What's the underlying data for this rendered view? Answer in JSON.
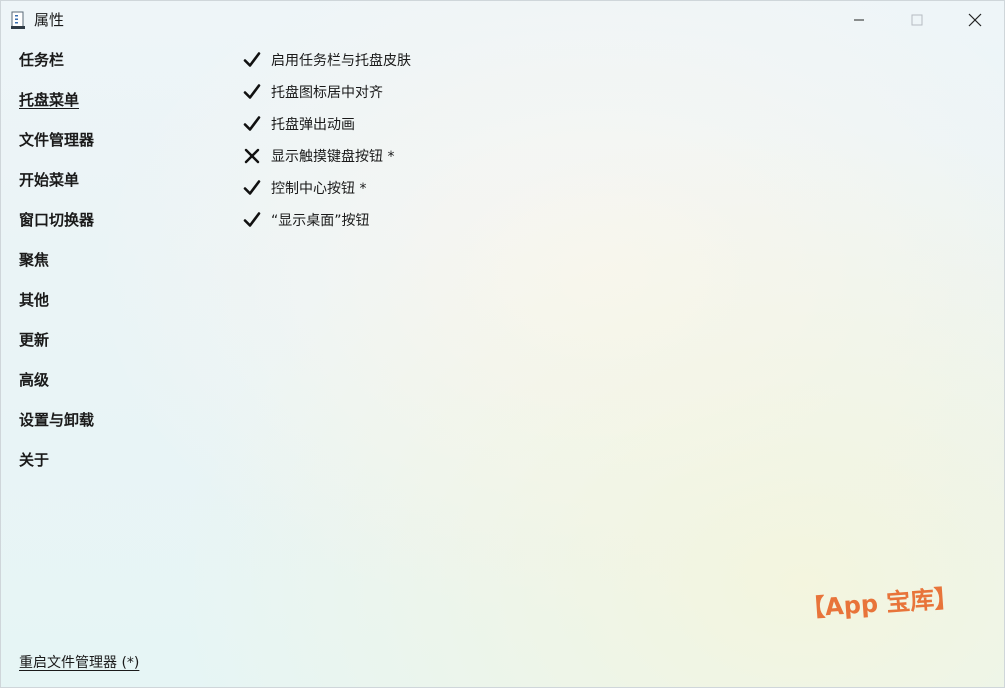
{
  "window": {
    "title": "属性"
  },
  "icons": {
    "app": "properties-icon",
    "minimize": "minimize-icon",
    "maximize": "maximize-icon",
    "close": "close-icon",
    "check": "checkmark-icon",
    "cross": "cross-icon"
  },
  "sidebar": {
    "items": [
      {
        "label": "任务栏",
        "active": false
      },
      {
        "label": "托盘菜单",
        "active": true
      },
      {
        "label": "文件管理器",
        "active": false
      },
      {
        "label": "开始菜单",
        "active": false
      },
      {
        "label": "窗口切换器",
        "active": false
      },
      {
        "label": "聚焦",
        "active": false
      },
      {
        "label": "其他",
        "active": false
      },
      {
        "label": "更新",
        "active": false
      },
      {
        "label": "高级",
        "active": false
      },
      {
        "label": "设置与卸载",
        "active": false
      },
      {
        "label": "关于",
        "active": false
      }
    ],
    "restart_link": "重启文件管理器 (*)"
  },
  "options": [
    {
      "label": "启用任务栏与托盘皮肤",
      "state": "checked"
    },
    {
      "label": "托盘图标居中对齐",
      "state": "checked"
    },
    {
      "label": "托盘弹出动画",
      "state": "checked"
    },
    {
      "label": "显示触摸键盘按钮 *",
      "state": "unchecked"
    },
    {
      "label": "控制中心按钮 *",
      "state": "checked"
    },
    {
      "label": "“显示桌面”按钮",
      "state": "checked"
    }
  ],
  "watermark": "【App 宝库】",
  "colors": {
    "watermark": "#e8743a",
    "text": "#1a1a1a"
  }
}
